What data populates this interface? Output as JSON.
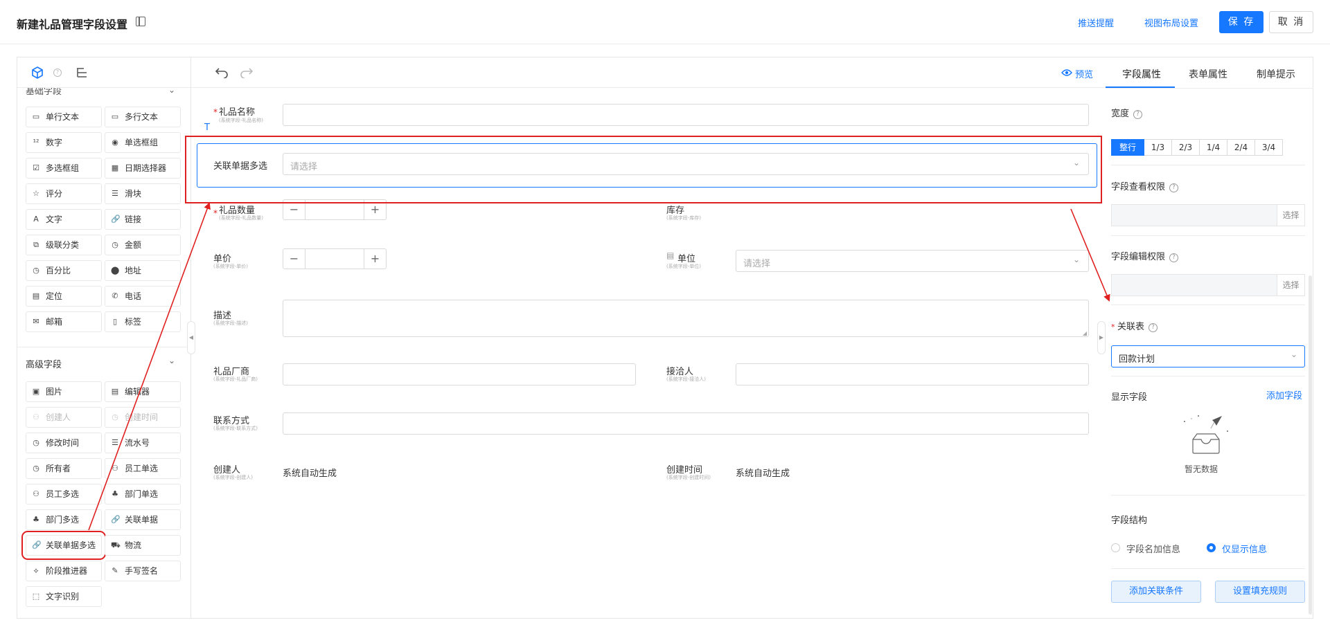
{
  "header": {
    "title": "新建礼品管理字段设置",
    "push_reminder": "推送提醒",
    "view_layout": "视图布局设置",
    "save": "保 存",
    "cancel": "取 消"
  },
  "left_panel": {
    "basic_group": "基础字段",
    "basic_fields": [
      "单行文本",
      "多行文本",
      "数字",
      "单选框组",
      "多选框组",
      "日期选择器",
      "评分",
      "滑块",
      "文字",
      "链接",
      "级联分类",
      "金额",
      "百分比",
      "地址",
      "定位",
      "电话",
      "邮箱",
      "标签"
    ],
    "advanced_group": "高级字段",
    "advanced_fields": [
      "图片",
      "编辑器",
      "创建人",
      "创建时间",
      "修改时间",
      "流水号",
      "所有者",
      "员工单选",
      "员工多选",
      "部门单选",
      "部门多选",
      "关联单据",
      "关联单据多选",
      "物流",
      "阶段推进器",
      "手写签名",
      "文字识别"
    ],
    "disabled_fields": [
      "创建人",
      "创建时间"
    ],
    "highlighted_field": "关联单据多选"
  },
  "center": {
    "toolbar": {
      "preview": "预览"
    },
    "gift_name": {
      "label": "礼品名称",
      "sub": "(系统字段-礼品名称)"
    },
    "rel_multi": {
      "label": "关联单据多选",
      "placeholder": "请选择"
    },
    "gift_qty": {
      "label": "礼品数量",
      "sub": "(系统字段-礼品数量)"
    },
    "stock": {
      "label": "库存",
      "sub": "(系统字段-库存)"
    },
    "price": {
      "label": "单价",
      "sub": "(系统字段-单价)"
    },
    "unit": {
      "label": "单位",
      "sub": "(系统字段-单位)",
      "placeholder": "请选择"
    },
    "desc": {
      "label": "描述",
      "sub": "(系统字段-描述)"
    },
    "vendor": {
      "label": "礼品厂商",
      "sub": "(系统字段-礼品厂商)"
    },
    "contact_person": {
      "label": "接洽人",
      "sub": "(系统字段-接洽人)"
    },
    "contact_info": {
      "label": "联系方式",
      "sub": "(系统字段-联系方式)"
    },
    "creator": {
      "label": "创建人",
      "sub": "(系统字段-创建人)",
      "value": "系统自动生成"
    },
    "create_time": {
      "label": "创建时间",
      "sub": "(系统字段-创建时间)",
      "value": "系统自动生成"
    }
  },
  "right_panel": {
    "tabs": [
      "字段属性",
      "表单属性",
      "制单提示"
    ],
    "active_tab": "字段属性",
    "width_label": "宽度",
    "width_options": [
      "整行",
      "1/3",
      "2/3",
      "1/4",
      "2/4",
      "3/4"
    ],
    "width_selected": "整行",
    "view_perm_label": "字段查看权限",
    "edit_perm_label": "字段编辑权限",
    "select_label": "选择",
    "rel_table_label": "关联表",
    "rel_table_value": "回款计划",
    "display_fields_label": "显示字段",
    "add_field": "添加字段",
    "empty_text": "暂无数据",
    "structure_label": "字段结构",
    "structure_options": [
      "字段名加信息",
      "仅显示信息"
    ],
    "structure_selected": "仅显示信息",
    "add_condition": "添加关联条件",
    "fill_rule": "设置填充规则"
  },
  "colors": {
    "primary": "#1677ff",
    "annotation": "#e02020",
    "border": "#d9d9d9"
  }
}
